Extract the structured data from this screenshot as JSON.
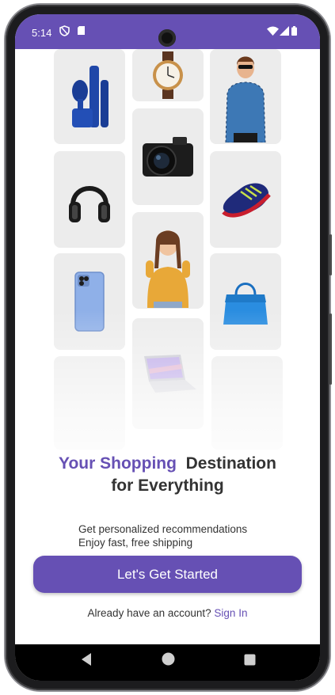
{
  "status_bar": {
    "time": "5:14",
    "left_icons": [
      "shield-icon",
      "sd-card-icon"
    ],
    "right_icons": [
      "wifi-icon",
      "signal-icon",
      "battery-icon"
    ],
    "background": "#6650b4"
  },
  "product_grid": {
    "items": [
      {
        "name": "shaving-kit",
        "icon": "razor-icon"
      },
      {
        "name": "wristwatch",
        "icon": "watch-icon"
      },
      {
        "name": "man-in-shirt",
        "icon": "person-icon"
      },
      {
        "name": "headphones",
        "icon": "headphones-icon"
      },
      {
        "name": "camera",
        "icon": "camera-icon"
      },
      {
        "name": "sneaker",
        "icon": "shoe-icon"
      },
      {
        "name": "woman-smiling",
        "icon": "person-icon"
      },
      {
        "name": "smartphone",
        "icon": "phone-icon"
      },
      {
        "name": "handbag",
        "icon": "bag-icon"
      },
      {
        "name": "laptop",
        "icon": "laptop-icon"
      }
    ]
  },
  "hero": {
    "headline_accent": "Your Shopping",
    "headline_rest_1": "Destination",
    "headline_line2": "for Everything",
    "desc_line1": "Get personalized recommendations",
    "desc_line2": "Enjoy fast, free shipping"
  },
  "cta": {
    "label": "Let's Get Started"
  },
  "signin": {
    "prompt": "Already have an account?",
    "link": "Sign In"
  },
  "colors": {
    "accent": "#6650b4",
    "text": "#333333",
    "tile": "#ececec"
  },
  "nav_bar": {
    "icons": [
      "back-icon",
      "home-icon",
      "recents-icon"
    ]
  }
}
